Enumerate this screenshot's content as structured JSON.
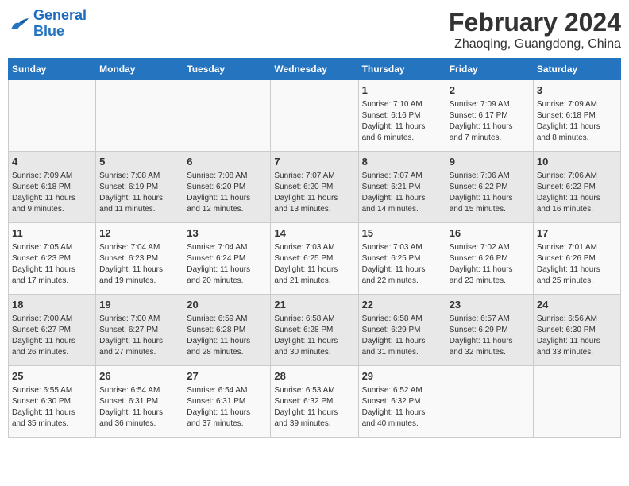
{
  "logo": {
    "line1": "General",
    "line2": "Blue"
  },
  "title": "February 2024",
  "subtitle": "Zhaoqing, Guangdong, China",
  "weekdays": [
    "Sunday",
    "Monday",
    "Tuesday",
    "Wednesday",
    "Thursday",
    "Friday",
    "Saturday"
  ],
  "weeks": [
    [
      {
        "day": "",
        "info": ""
      },
      {
        "day": "",
        "info": ""
      },
      {
        "day": "",
        "info": ""
      },
      {
        "day": "",
        "info": ""
      },
      {
        "day": "1",
        "info": "Sunrise: 7:10 AM\nSunset: 6:16 PM\nDaylight: 11 hours\nand 6 minutes."
      },
      {
        "day": "2",
        "info": "Sunrise: 7:09 AM\nSunset: 6:17 PM\nDaylight: 11 hours\nand 7 minutes."
      },
      {
        "day": "3",
        "info": "Sunrise: 7:09 AM\nSunset: 6:18 PM\nDaylight: 11 hours\nand 8 minutes."
      }
    ],
    [
      {
        "day": "4",
        "info": "Sunrise: 7:09 AM\nSunset: 6:18 PM\nDaylight: 11 hours\nand 9 minutes."
      },
      {
        "day": "5",
        "info": "Sunrise: 7:08 AM\nSunset: 6:19 PM\nDaylight: 11 hours\nand 11 minutes."
      },
      {
        "day": "6",
        "info": "Sunrise: 7:08 AM\nSunset: 6:20 PM\nDaylight: 11 hours\nand 12 minutes."
      },
      {
        "day": "7",
        "info": "Sunrise: 7:07 AM\nSunset: 6:20 PM\nDaylight: 11 hours\nand 13 minutes."
      },
      {
        "day": "8",
        "info": "Sunrise: 7:07 AM\nSunset: 6:21 PM\nDaylight: 11 hours\nand 14 minutes."
      },
      {
        "day": "9",
        "info": "Sunrise: 7:06 AM\nSunset: 6:22 PM\nDaylight: 11 hours\nand 15 minutes."
      },
      {
        "day": "10",
        "info": "Sunrise: 7:06 AM\nSunset: 6:22 PM\nDaylight: 11 hours\nand 16 minutes."
      }
    ],
    [
      {
        "day": "11",
        "info": "Sunrise: 7:05 AM\nSunset: 6:23 PM\nDaylight: 11 hours\nand 17 minutes."
      },
      {
        "day": "12",
        "info": "Sunrise: 7:04 AM\nSunset: 6:23 PM\nDaylight: 11 hours\nand 19 minutes."
      },
      {
        "day": "13",
        "info": "Sunrise: 7:04 AM\nSunset: 6:24 PM\nDaylight: 11 hours\nand 20 minutes."
      },
      {
        "day": "14",
        "info": "Sunrise: 7:03 AM\nSunset: 6:25 PM\nDaylight: 11 hours\nand 21 minutes."
      },
      {
        "day": "15",
        "info": "Sunrise: 7:03 AM\nSunset: 6:25 PM\nDaylight: 11 hours\nand 22 minutes."
      },
      {
        "day": "16",
        "info": "Sunrise: 7:02 AM\nSunset: 6:26 PM\nDaylight: 11 hours\nand 23 minutes."
      },
      {
        "day": "17",
        "info": "Sunrise: 7:01 AM\nSunset: 6:26 PM\nDaylight: 11 hours\nand 25 minutes."
      }
    ],
    [
      {
        "day": "18",
        "info": "Sunrise: 7:00 AM\nSunset: 6:27 PM\nDaylight: 11 hours\nand 26 minutes."
      },
      {
        "day": "19",
        "info": "Sunrise: 7:00 AM\nSunset: 6:27 PM\nDaylight: 11 hours\nand 27 minutes."
      },
      {
        "day": "20",
        "info": "Sunrise: 6:59 AM\nSunset: 6:28 PM\nDaylight: 11 hours\nand 28 minutes."
      },
      {
        "day": "21",
        "info": "Sunrise: 6:58 AM\nSunset: 6:28 PM\nDaylight: 11 hours\nand 30 minutes."
      },
      {
        "day": "22",
        "info": "Sunrise: 6:58 AM\nSunset: 6:29 PM\nDaylight: 11 hours\nand 31 minutes."
      },
      {
        "day": "23",
        "info": "Sunrise: 6:57 AM\nSunset: 6:29 PM\nDaylight: 11 hours\nand 32 minutes."
      },
      {
        "day": "24",
        "info": "Sunrise: 6:56 AM\nSunset: 6:30 PM\nDaylight: 11 hours\nand 33 minutes."
      }
    ],
    [
      {
        "day": "25",
        "info": "Sunrise: 6:55 AM\nSunset: 6:30 PM\nDaylight: 11 hours\nand 35 minutes."
      },
      {
        "day": "26",
        "info": "Sunrise: 6:54 AM\nSunset: 6:31 PM\nDaylight: 11 hours\nand 36 minutes."
      },
      {
        "day": "27",
        "info": "Sunrise: 6:54 AM\nSunset: 6:31 PM\nDaylight: 11 hours\nand 37 minutes."
      },
      {
        "day": "28",
        "info": "Sunrise: 6:53 AM\nSunset: 6:32 PM\nDaylight: 11 hours\nand 39 minutes."
      },
      {
        "day": "29",
        "info": "Sunrise: 6:52 AM\nSunset: 6:32 PM\nDaylight: 11 hours\nand 40 minutes."
      },
      {
        "day": "",
        "info": ""
      },
      {
        "day": "",
        "info": ""
      }
    ]
  ]
}
